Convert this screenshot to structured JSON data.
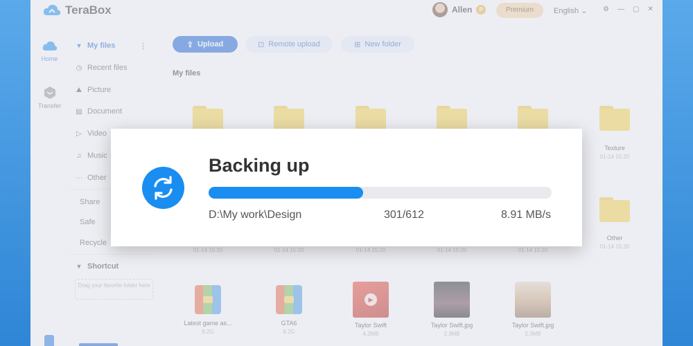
{
  "app": {
    "name": "TeraBox"
  },
  "user": {
    "name": "Allen",
    "badge": "P",
    "premium_label": "Premium",
    "language": "English"
  },
  "window_controls": [
    "⚙",
    "—",
    "▢",
    "✕"
  ],
  "rail": [
    {
      "label": "Home",
      "icon": "cloud-icon"
    },
    {
      "label": "Transfer",
      "icon": "transfer-icon"
    }
  ],
  "sidebar": {
    "my_files": "My files",
    "items": [
      {
        "label": "Recent files",
        "icon": "clock-icon"
      },
      {
        "label": "Picture",
        "icon": "picture-icon"
      },
      {
        "label": "Document",
        "icon": "document-icon"
      },
      {
        "label": "Video",
        "icon": "video-icon"
      },
      {
        "label": "Music",
        "icon": "music-icon"
      },
      {
        "label": "Other",
        "icon": "more-icon"
      },
      {
        "label": "Share",
        "icon": ""
      },
      {
        "label": "Safe",
        "icon": ""
      },
      {
        "label": "Recycle",
        "icon": ""
      }
    ],
    "shortcut_title": "Shortcut",
    "shortcut_hint": "Drag your favorite folder here"
  },
  "toolbar": {
    "upload": "Upload",
    "remote_upload": "Remote upload",
    "new_folder": "New folder"
  },
  "breadcrumb": "My files",
  "files_row1": [
    {
      "name": "",
      "meta": ""
    },
    {
      "name": "",
      "meta": ""
    },
    {
      "name": "",
      "meta": ""
    },
    {
      "name": "",
      "meta": ""
    },
    {
      "name": "",
      "meta": ""
    },
    {
      "name": "Texture",
      "meta": "01-14 15:20"
    }
  ],
  "files_row2": [
    {
      "name": "",
      "meta": "01-14 15:20"
    },
    {
      "name": "",
      "meta": "01-14 15:20"
    },
    {
      "name": "",
      "meta": "01-14 15:20"
    },
    {
      "name": "",
      "meta": "01-14 15:20"
    },
    {
      "name": "",
      "meta": "01-14 15:20"
    },
    {
      "name": "Other",
      "meta": "01-14 15:20"
    }
  ],
  "files_row3": [
    {
      "name": "Latest game as...",
      "meta": "8.2G",
      "kind": "archive"
    },
    {
      "name": "GTA6",
      "meta": "8.2G",
      "kind": "archive"
    },
    {
      "name": "Taylor Swift",
      "meta": "4.3MB",
      "kind": "video"
    },
    {
      "name": "Taylor Swift.jpg",
      "meta": "2.3MB",
      "kind": "image"
    },
    {
      "name": "Taylor Swift.jpg",
      "meta": "2.3MB",
      "kind": "image"
    }
  ],
  "backup": {
    "title": "Backing up",
    "progress": 0.45,
    "path": "D:\\My work\\Design",
    "count": "301/612",
    "speed": "8.91 MB/s"
  },
  "colors": {
    "accent": "#1a8ef0",
    "upload": "#1a63d8",
    "folder": "#f7d24f"
  }
}
